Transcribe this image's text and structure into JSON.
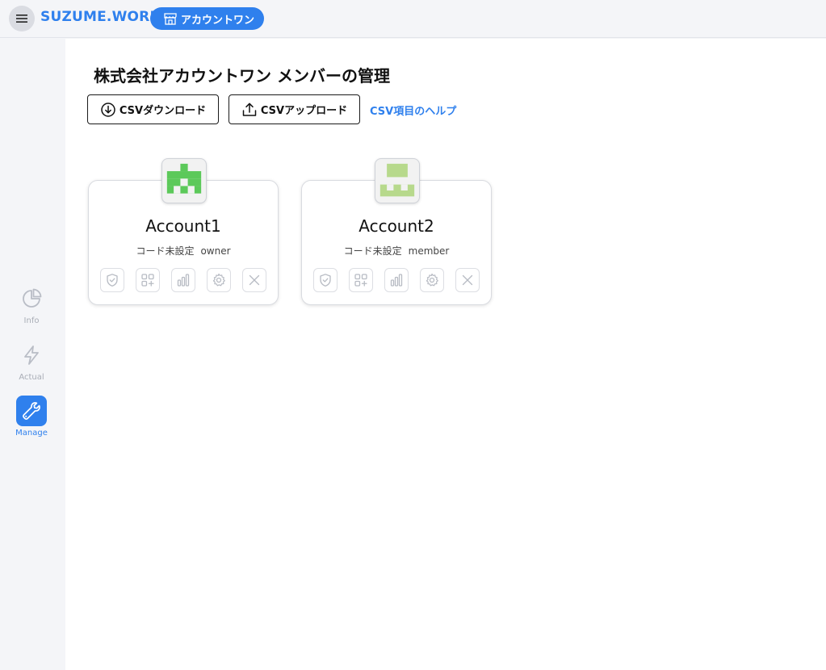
{
  "header": {
    "brand": "SUZUME.WORK",
    "account_name": "アカウントワン"
  },
  "sidebar": {
    "items": [
      {
        "label": "Info",
        "icon": "pie-chart-icon",
        "active": false
      },
      {
        "label": "Actual",
        "icon": "lightning-icon",
        "active": false
      },
      {
        "label": "Manage",
        "icon": "wrench-icon",
        "active": true
      }
    ]
  },
  "main": {
    "title": "株式会社アカウントワン メンバーの管理",
    "csv_download_label": "CSVダウンロード",
    "csv_upload_label": "CSVアップロード",
    "csv_help_label": "CSV項目のヘルプ"
  },
  "members": [
    {
      "name": "Account1",
      "code": "コード未設定",
      "role": "owner",
      "avatar_color": "#5cc95a"
    },
    {
      "name": "Account2",
      "code": "コード未設定",
      "role": "member",
      "avatar_color": "#b7d98c"
    }
  ],
  "colors": {
    "accent": "#2f80ed",
    "sidebar_bg": "#f4f5f8"
  }
}
